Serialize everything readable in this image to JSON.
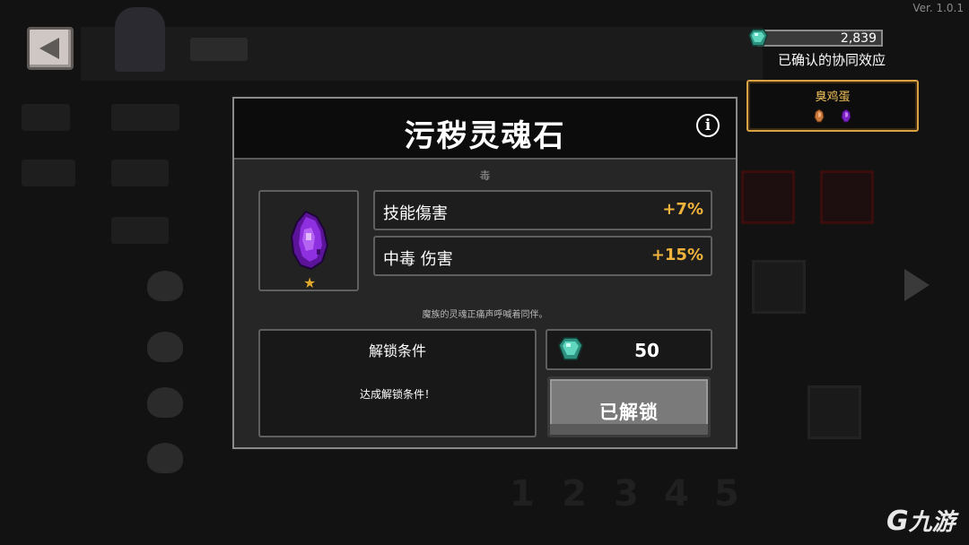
{
  "version": "Ver. 1.0.1",
  "currency": {
    "gems": "2,839",
    "icon": "teal-gem-icon"
  },
  "synergy": {
    "section_title": "已确认的协同效应",
    "card_name": "臭鸡蛋",
    "card_icons": [
      "orange-stone-icon",
      "purple-stone-icon"
    ]
  },
  "back_button": {
    "icon": "back-arrow-icon"
  },
  "modal": {
    "title": "污秽灵魂石",
    "element": "毒",
    "item_icon": "purple-soul-stone-icon",
    "rarity_icon": "star-icon",
    "rarity_star": "★",
    "info_icon": "info-icon",
    "info_glyph": "i",
    "stats": [
      {
        "label": "技能傷害",
        "value": "+7%"
      },
      {
        "label": "中毒 伤害",
        "value": "+15%"
      }
    ],
    "flavor_text": "魔族的灵魂正痛声呼喊着同伴。",
    "unlock": {
      "title": "解锁条件",
      "description": "达成解锁条件！"
    },
    "cost": "50",
    "status_button": "已解锁"
  },
  "background": {
    "page_numbers": [
      "1",
      "2",
      "3",
      "4",
      "5"
    ]
  },
  "watermark": {
    "glyph": "G",
    "text": "九游"
  },
  "colors": {
    "accent_gold": "#f0b43c",
    "synergy_border": "#d9a244",
    "gem_teal": "#3fbfa6",
    "stone_purple": "#8a2bd8"
  }
}
